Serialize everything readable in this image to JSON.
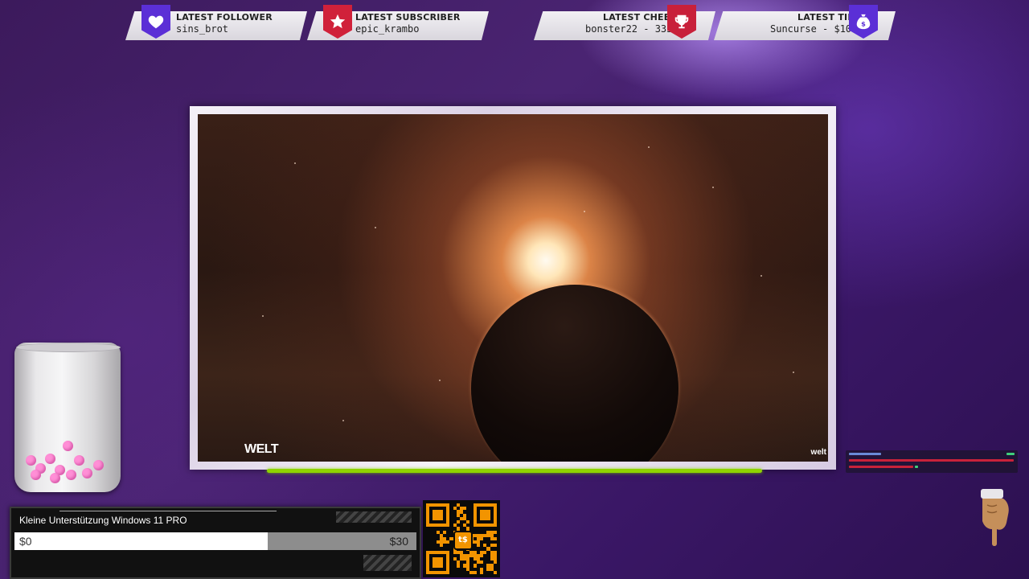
{
  "alerts": {
    "follower": {
      "title": "LATEST FOLLOWER",
      "value": "sins_brot",
      "icon": "heart-icon",
      "color": "#5b2fd6"
    },
    "subscriber": {
      "title": "LATEST SUBSCRIBER",
      "value": "epic_krambo",
      "icon": "star-icon",
      "color": "#d0213a"
    },
    "cheer": {
      "title": "LATEST CHEER",
      "value": "bonster22 - 333",
      "icon": "trophy-icon",
      "color": "#c8203a"
    },
    "tip": {
      "title": "LATEST TIP",
      "value": "Suncurse - $10",
      "icon": "money-bag-icon",
      "color": "#5b2fd6"
    }
  },
  "video": {
    "watermark_left": "WELT",
    "watermark_right": "welt"
  },
  "goal": {
    "title": "Kleine Unterstützung Windows 11 PRO",
    "start_label": "$0",
    "end_label": "$30",
    "progress_fraction": 0.63
  },
  "qr": {
    "logo_text": "t$",
    "color": "#f29400"
  },
  "accent_progress_color": "#8fd400"
}
